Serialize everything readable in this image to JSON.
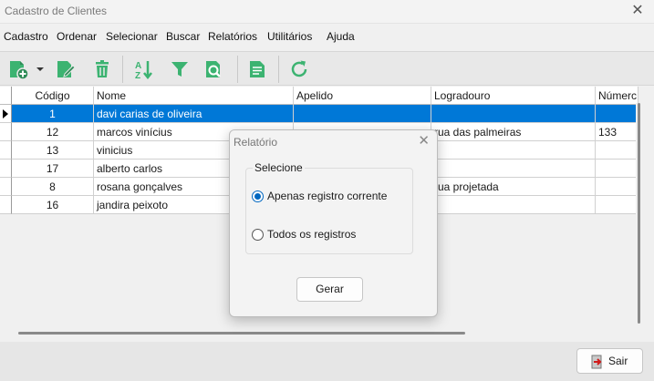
{
  "window": {
    "title": "Cadastro de Clientes"
  },
  "menu": [
    "Cadastro",
    "Ordenar",
    "Selecionar",
    "Buscar",
    "Relatórios",
    "Utilitários",
    "Ajuda"
  ],
  "toolbar": {
    "icons": [
      "add-record-icon",
      "dropdown-arrow-icon",
      "edit-icon",
      "delete-icon",
      "sort-icon",
      "filter-icon",
      "search-icon",
      "report-icon",
      "refresh-icon"
    ],
    "accent": "#3cb371"
  },
  "grid": {
    "columns": [
      "Código",
      "Nome",
      "Apelido",
      "Logradouro",
      "Númerc"
    ],
    "rows": [
      {
        "codigo": "1",
        "nome": "davi carias de oliveira",
        "apelido": "",
        "logradouro": "",
        "numero": ""
      },
      {
        "codigo": "12",
        "nome": "marcos vinícius",
        "apelido": "",
        "logradouro": "rua das palmeiras",
        "numero": "133"
      },
      {
        "codigo": "13",
        "nome": "vinicius",
        "apelido": "",
        "logradouro": "",
        "numero": ""
      },
      {
        "codigo": "17",
        "nome": "alberto carlos",
        "apelido": "",
        "logradouro": "",
        "numero": ""
      },
      {
        "codigo": "8",
        "nome": "rosana gonçalves",
        "apelido": "",
        "logradouro": "rua projetada",
        "numero": ""
      },
      {
        "codigo": "16",
        "nome": "jandira peixoto",
        "apelido": "",
        "logradouro": "",
        "numero": ""
      }
    ],
    "selected_color": "#0078d7"
  },
  "dialog": {
    "title": "Relatório",
    "group_label": "Selecione",
    "options": [
      "Apenas registro corrente",
      "Todos os registros"
    ],
    "selected_option": "Apenas registro corrente",
    "button": "Gerar"
  },
  "footer": {
    "exit_label": "Sair"
  }
}
